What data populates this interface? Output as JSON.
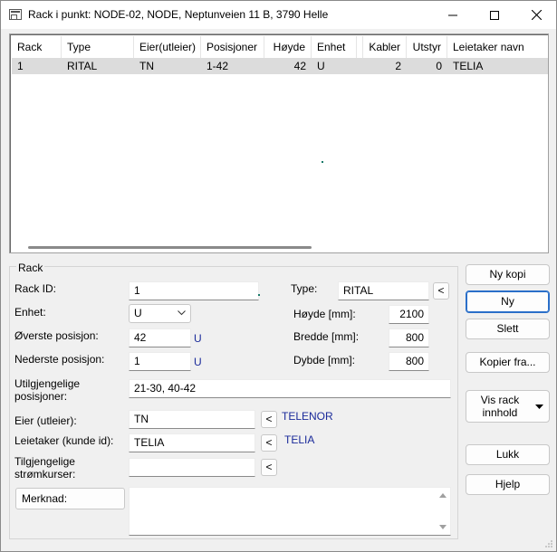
{
  "window": {
    "title": "Rack i punkt: NODE-02, NODE, Neptunveien 11 B, 3790 Helle"
  },
  "table": {
    "columns": [
      "Rack",
      "Type",
      "Eier(utleier)",
      "Posisjoner",
      "Høyde",
      "Enhet",
      "Kabler",
      "Utstyr",
      "Leietaker navn"
    ],
    "rows": [
      [
        "1",
        "RITAL",
        "TN",
        "1-42",
        "42",
        "U",
        "2",
        "0",
        "TELIA"
      ]
    ]
  },
  "form": {
    "group_label": "Rack",
    "rack_id_label": "Rack ID:",
    "rack_id_value": "1",
    "type_label": "Type:",
    "type_value": "RITAL",
    "enhet_label": "Enhet:",
    "enhet_value": "U",
    "hoyde_label": "Høyde [mm]:",
    "hoyde_value": "2100",
    "overste_label": "Øverste posisjon:",
    "overste_value": "42",
    "overste_unit": "U",
    "bredde_label": "Bredde [mm]:",
    "bredde_value": "800",
    "nederste_label": "Nederste posisjon:",
    "nederste_value": "1",
    "nederste_unit": "U",
    "dybde_label": "Dybde [mm]:",
    "dybde_value": "800",
    "utilgj_label_1": "Utilgjengelige",
    "utilgj_label_2": "posisjoner:",
    "utilgj_value": "21-30, 40-42",
    "eier_label": "Eier (utleier):",
    "eier_value": "TN",
    "eier_name": "TELENOR",
    "leietaker_label": "Leietaker (kunde id):",
    "leietaker_value": "TELIA",
    "leietaker_name": "TELIA",
    "strom_label_1": "Tilgjengelige",
    "strom_label_2": "strømkurser:",
    "strom_value": "",
    "merknad_label": "Merknad:",
    "merknad_value": "",
    "pick_button": "<"
  },
  "buttons": {
    "ny_kopi": "Ny kopi",
    "ny": "Ny",
    "slett": "Slett",
    "kopier_fra": "Kopier fra...",
    "vis_rack_1": "Vis rack",
    "vis_rack_2": "innhold",
    "lukk": "Lukk",
    "hjelp": "Hjelp"
  },
  "icons": {
    "app": "rack-app-icon",
    "minimize": "minimize-icon",
    "maximize": "maximize-icon",
    "close": "close-icon",
    "dropdown": "chevron-down-icon",
    "menu_arrow": "triangle-down-icon"
  }
}
